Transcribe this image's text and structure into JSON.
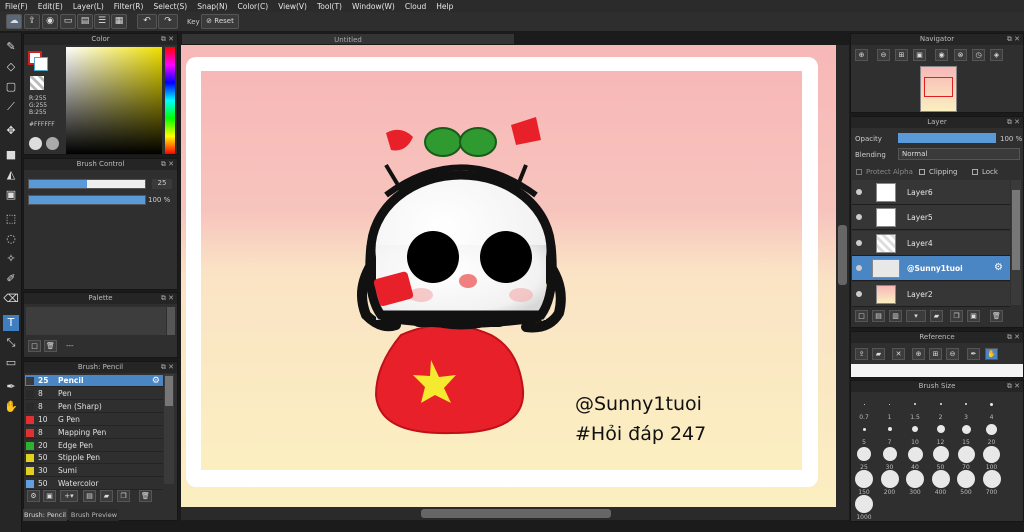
{
  "menu": [
    "File(F)",
    "Edit(E)",
    "Layer(L)",
    "Filter(R)",
    "Select(S)",
    "Snap(N)",
    "Color(C)",
    "View(V)",
    "Tool(T)",
    "Window(W)",
    "Cloud",
    "Help"
  ],
  "toolbar": {
    "key_label": "Key",
    "reset_label": "Reset"
  },
  "document": {
    "tab_title": "Untitled",
    "text_line1": "@Sunny1tuoi",
    "text_line2": "#Hỏi đáp 247"
  },
  "color_panel": {
    "title": "Color",
    "r": "R:255",
    "g": "G:255",
    "b": "B:255",
    "hex": "#FFFFFF"
  },
  "brush_control": {
    "title": "Brush Control",
    "size": "25",
    "opacity": "100 %"
  },
  "palette": {
    "title": "Palette",
    "value": "---"
  },
  "brush_list": {
    "title": "Brush: Pencil",
    "items": [
      {
        "size": "25",
        "name": "Pencil",
        "color": "#3a3a3a"
      },
      {
        "size": "8",
        "name": "Pen",
        "color": "#2a2a2a"
      },
      {
        "size": "8",
        "name": "Pen (Sharp)",
        "color": "#2a2a2a"
      },
      {
        "size": "10",
        "name": "G Pen",
        "color": "#e03030"
      },
      {
        "size": "8",
        "name": "Mapping Pen",
        "color": "#e03030"
      },
      {
        "size": "20",
        "name": "Edge Pen",
        "color": "#30b030"
      },
      {
        "size": "50",
        "name": "Stipple Pen",
        "color": "#e0d020"
      },
      {
        "size": "30",
        "name": "Sumi",
        "color": "#e0d020"
      },
      {
        "size": "50",
        "name": "Watercolor",
        "color": "#60a0e0"
      }
    ],
    "tab1": "Brush: Pencil",
    "tab2": "Brush Preview"
  },
  "navigator": {
    "title": "Navigator"
  },
  "layer_panel": {
    "title": "Layer",
    "opacity_label": "Opacity",
    "opacity_value": "100 %",
    "blending_label": "Blending",
    "blending_value": "Normal",
    "protect_alpha": "Protect Alpha",
    "clipping": "Clipping",
    "lock": "Lock",
    "layers": [
      {
        "name": "Layer6"
      },
      {
        "name": "Layer5"
      },
      {
        "name": "Layer4"
      },
      {
        "name": "@Sunny1tuoi"
      },
      {
        "name": "Layer2"
      }
    ]
  },
  "reference": {
    "title": "Reference"
  },
  "brush_size": {
    "title": "Brush Size",
    "sizes": [
      "0.7",
      "1",
      "1.5",
      "2",
      "3",
      "4",
      "5",
      "7",
      "10",
      "12",
      "15",
      "20",
      "25",
      "30",
      "40",
      "50",
      "70",
      "100",
      "150",
      "200",
      "300",
      "400",
      "500",
      "700",
      "1000"
    ]
  }
}
